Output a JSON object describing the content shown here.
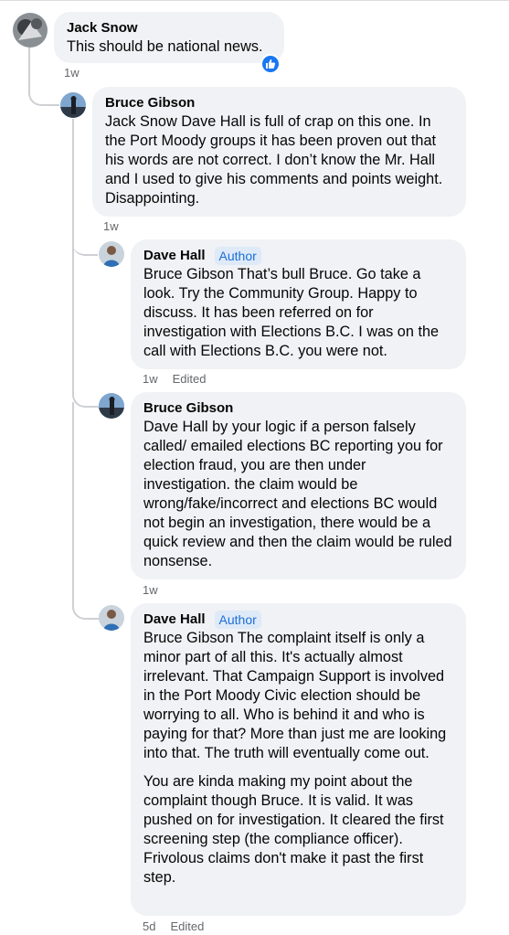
{
  "comments": [
    {
      "author": "Jack Snow",
      "badge": "",
      "paragraphs": [
        "This should be national news."
      ],
      "time": "1w",
      "edited": ""
    },
    {
      "author": "Bruce Gibson",
      "badge": "",
      "paragraphs": [
        "Jack Snow Dave Hall is full of crap on this one. In the Port Moody groups it has been proven out that his words are not correct. I don’t know the Mr. Hall and I used to give his comments and points weight. Disappointing."
      ],
      "time": "1w",
      "edited": ""
    },
    {
      "author": "Dave Hall",
      "badge": "Author",
      "paragraphs": [
        "Bruce Gibson That’s bull Bruce. Go take a look. Try the Community Group. Happy to discuss. It has been referred on for investigation with Elections B.C. I was on the call with Elections B.C. you were not."
      ],
      "time": "1w",
      "edited": "Edited"
    },
    {
      "author": "Bruce Gibson",
      "badge": "",
      "paragraphs": [
        "Dave Hall by your logic if a person falsely called/ emailed elections BC reporting you for election fraud, you are then under investigation. the claim would be wrong/fake/incorrect and elections BC would not begin an investigation, there would be a quick review and then the claim would be ruled nonsense."
      ],
      "time": "1w",
      "edited": ""
    },
    {
      "author": "Dave Hall",
      "badge": "Author",
      "paragraphs": [
        "Bruce Gibson The complaint itself is only a minor part of all this. It's actually almost irrelevant. That Campaign Support is involved in the Port Moody Civic election should be worrying to all. Who is behind it and who is paying for that? More than just me are looking into that. The truth will eventually come out.",
        "You are kinda making my point about the complaint though Bruce. It is valid. It was pushed on for investigation. It cleared the first screening step (the compliance officer). Frivolous claims don't make it past the first step."
      ],
      "time": "5d",
      "edited": "Edited"
    }
  ],
  "reaction": {
    "icon": "like-icon",
    "color": "#1877f2"
  }
}
